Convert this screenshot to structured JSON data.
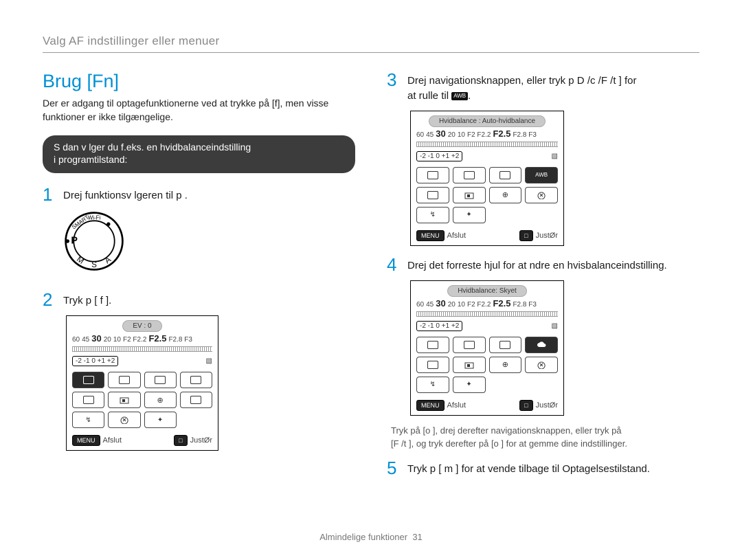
{
  "breadcrumb": "Valg AF indstillinger eller menuer",
  "title": "Brug [Fn]",
  "intro": "Der er adgang til optagefunktionerne ved at trykke på [f], men visse funktioner er ikke tilgængelige.",
  "pill_line1": "S dan v lger du f.eks. en hvidbalanceindstilling",
  "pill_line2": "i programtilstand:",
  "step1": "Drej funktionsv lgeren til p .",
  "step2": "Tryk p  [ f    ].",
  "step3a": "Drej navigationsknappen, eller tryk p  D",
  "step3b": "/c  /F /t     ] for",
  "step3c": "at rulle til",
  "step4": "Drej det forreste hjul for at  ndre en hvisbalanceindstilling.",
  "note1": "Tryk på [o    ], drej derefter navigationsknappen, eller tryk på",
  "note2": "[F /t     ], og tryk derefter på [o    ] for at gemme dine indstillinger.",
  "step5": "Tryk p  [ m        ] for at vende tilbage til Optagelsestilstand.",
  "lcd1": {
    "badge": "EV : 0",
    "shutter_row": [
      "60",
      "45",
      "30",
      "20",
      "10",
      "F2 F2.2",
      "F2.5",
      "F2.8 F3"
    ],
    "ev_scale": "-2  -1  0  +1 +2",
    "foot_left_key": "MENU",
    "foot_left": "Afslut",
    "foot_right_key": "□",
    "foot_right": "JustØr"
  },
  "lcd2": {
    "badge": "Hvidbalance : Auto-hvidbalance",
    "shutter_row": [
      "60",
      "45",
      "30",
      "20",
      "10",
      "F2 F2.2",
      "F2.5",
      "F2.8 F3"
    ],
    "ev_scale": "-2  -1  0  +1 +2",
    "foot_left_key": "MENU",
    "foot_left": "Afslut",
    "foot_right_key": "□",
    "foot_right": "JustØr"
  },
  "lcd3": {
    "badge": "Hvidbalance: Skyet",
    "shutter_row": [
      "60",
      "45",
      "30",
      "20",
      "10",
      "F2 F2.2",
      "F2.5",
      "F2.8 F3"
    ],
    "ev_scale": "-2  -1  0  +1 +2",
    "foot_left_key": "MENU",
    "foot_left": "Afslut",
    "foot_right_key": "□",
    "foot_right": "JustØr"
  },
  "step_nums": {
    "s1": "1",
    "s2": "2",
    "s3": "3",
    "s4": "4",
    "s5": "5"
  },
  "footer_label": "Almindelige funktioner",
  "footer_page": "31",
  "awb_label": "AWB"
}
